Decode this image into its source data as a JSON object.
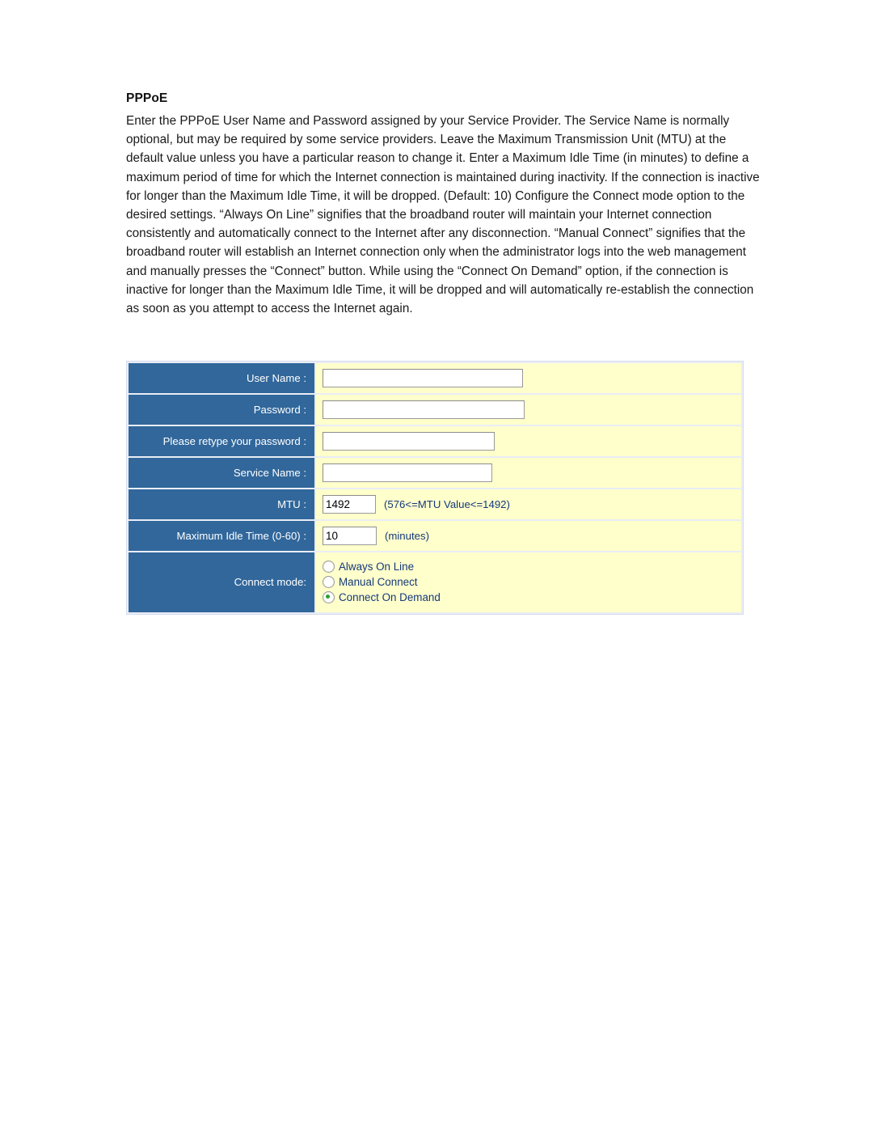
{
  "document": {
    "heading": "PPPoE",
    "paragraph": "Enter the PPPoE User Name and Password assigned by your Service Provider. The Service Name is normally optional, but may be required by some service providers. Leave the Maximum Transmission Unit (MTU) at the default value unless you have a particular reason to change it. Enter a Maximum Idle Time (in minutes) to define a maximum period of time for which the Internet connection is maintained during inactivity. If the connection is inactive for longer than the Maximum Idle Time, it will be dropped. (Default: 10) Configure the Connect mode option to the desired settings. “Always On Line” signifies that the broadband router will maintain your Internet connection consistently and automatically connect to the Internet after any disconnection. “Manual Connect” signifies that the broadband router will establish an Internet connection only when the administrator logs into the web management and manually presses the “Connect” button. While using the “Connect On Demand” option, if the connection is inactive for longer than the Maximum Idle Time, it will be dropped and will automatically re-establish the connection as soon as you attempt to access the Internet again."
  },
  "form": {
    "rows": {
      "user_name": {
        "label": "User Name :",
        "value": "",
        "placeholder": ""
      },
      "password": {
        "label": "Password :",
        "value": "",
        "placeholder": ""
      },
      "retype_password": {
        "label": "Please retype your password :",
        "value": "",
        "placeholder": ""
      },
      "service_name": {
        "label": "Service Name :",
        "value": "",
        "placeholder": ""
      },
      "mtu": {
        "label": "MTU :",
        "value": "1492",
        "hint": "(576<=MTU Value<=1492)"
      },
      "max_idle_time": {
        "label": "Maximum Idle Time (0-60) :",
        "value": "10",
        "hint": "(minutes)"
      },
      "connect_mode": {
        "label": "Connect mode:",
        "options": [
          {
            "label": "Always On Line",
            "selected": false
          },
          {
            "label": "Manual Connect",
            "selected": false
          },
          {
            "label": "Connect On Demand",
            "selected": true
          }
        ]
      }
    }
  },
  "colors": {
    "label_cell_blue": "#31679b",
    "field_cell_yellow": "#ffffcc",
    "panel_border": "#d6dced",
    "hint_text_blue": "#15387a",
    "radio_selected_green": "#2f9e2f",
    "page_background": "#ffffff"
  }
}
